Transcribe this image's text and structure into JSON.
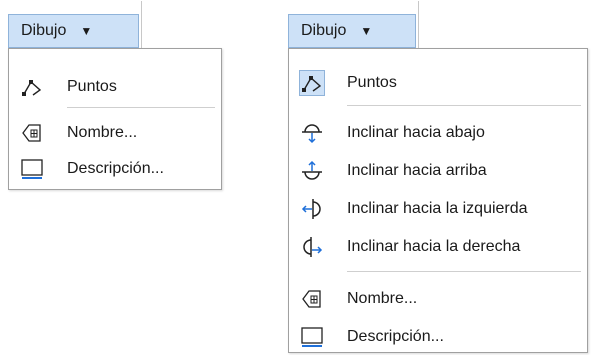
{
  "left_menu": {
    "button_label": "Dibujo",
    "caret": "▼",
    "items": [
      {
        "label": "Puntos",
        "icon": "points-icon"
      },
      {
        "label": "Nombre...",
        "icon": "name-icon"
      },
      {
        "label": "Descripción...",
        "icon": "description-icon"
      }
    ]
  },
  "right_menu": {
    "button_label": "Dibujo",
    "caret": "▼",
    "items": [
      {
        "label": "Puntos",
        "icon": "points-icon"
      },
      {
        "label": "Inclinar hacia abajo",
        "icon": "glue-down-icon"
      },
      {
        "label": "Inclinar hacia arriba",
        "icon": "glue-up-icon"
      },
      {
        "label": "Inclinar hacia la izquierda",
        "icon": "glue-left-icon"
      },
      {
        "label": "Inclinar hacia la derecha",
        "icon": "glue-right-icon"
      },
      {
        "label": "Nombre...",
        "icon": "name-icon"
      },
      {
        "label": "Descripción...",
        "icon": "description-icon"
      }
    ]
  },
  "colors": {
    "accent": "#cde1f7",
    "accent_border": "#8fb3da",
    "icon_blue": "#1e6fd9"
  }
}
